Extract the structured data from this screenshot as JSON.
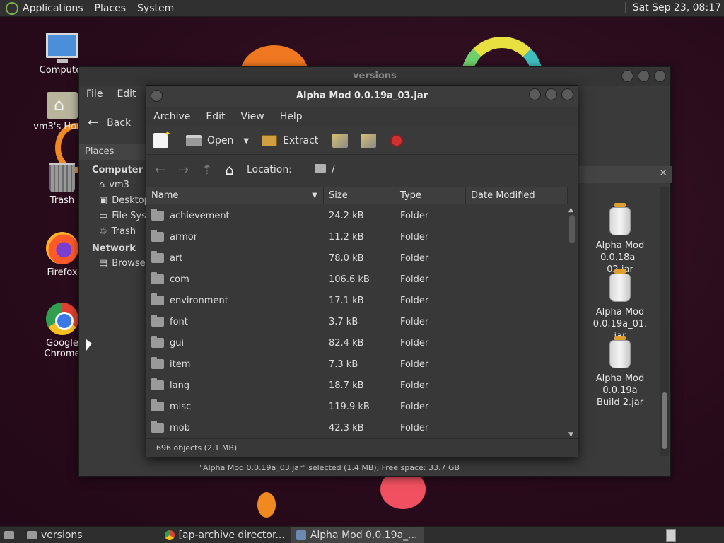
{
  "top_panel": {
    "menus": [
      "Applications",
      "Places",
      "System"
    ],
    "clock": "Sat Sep 23, 08:17"
  },
  "desktop": {
    "icons": [
      "Computer",
      "vm3's Home",
      "Trash",
      "Firefox",
      "Google Chrome"
    ]
  },
  "back_window": {
    "title": "versions",
    "menu": [
      "File",
      "Edit"
    ],
    "back_label": "Back",
    "places_label": "Places",
    "sidebar": {
      "computer_label": "Computer",
      "computer_items": [
        "vm3",
        "Desktop",
        "File System",
        "Trash"
      ],
      "network_label": "Network",
      "network_items": [
        "Browse Network"
      ]
    },
    "files": [
      {
        "line1": "Alpha Mod 0.0.18a_",
        "line2": "02.jar"
      },
      {
        "line1": "Alpha Mod 0.0.19a_01.",
        "line2": "jar"
      },
      {
        "line1": "Alpha Mod 0.0.19a",
        "line2": "Build 2.jar"
      }
    ],
    "status": "\"Alpha Mod 0.0.19a_03.jar\" selected (1.4 MB), Free space: 33.7 GB"
  },
  "archive_window": {
    "title": "Alpha Mod 0.0.19a_03.jar",
    "menu": [
      "Archive",
      "Edit",
      "View",
      "Help"
    ],
    "toolbar": {
      "open": "Open",
      "extract": "Extract"
    },
    "location_label": "Location:",
    "location_value": "/",
    "columns": [
      "Name",
      "Size",
      "Type",
      "Date Modified"
    ],
    "rows": [
      {
        "name": "achievement",
        "size": "24.2 kB",
        "type": "Folder",
        "date": ""
      },
      {
        "name": "armor",
        "size": "11.2 kB",
        "type": "Folder",
        "date": ""
      },
      {
        "name": "art",
        "size": "78.0 kB",
        "type": "Folder",
        "date": ""
      },
      {
        "name": "com",
        "size": "106.6 kB",
        "type": "Folder",
        "date": ""
      },
      {
        "name": "environment",
        "size": "17.1 kB",
        "type": "Folder",
        "date": ""
      },
      {
        "name": "font",
        "size": "3.7 kB",
        "type": "Folder",
        "date": ""
      },
      {
        "name": "gui",
        "size": "82.4 kB",
        "type": "Folder",
        "date": ""
      },
      {
        "name": "item",
        "size": "7.3 kB",
        "type": "Folder",
        "date": ""
      },
      {
        "name": "lang",
        "size": "18.7 kB",
        "type": "Folder",
        "date": ""
      },
      {
        "name": "misc",
        "size": "119.9 kB",
        "type": "Folder",
        "date": ""
      },
      {
        "name": "mob",
        "size": "42.3 kB",
        "type": "Folder",
        "date": ""
      }
    ],
    "status": "696 objects (2.1 MB)"
  },
  "taskbar": {
    "tasks": [
      "versions",
      "[ap-archive director...",
      "Alpha Mod 0.0.19a_..."
    ]
  }
}
